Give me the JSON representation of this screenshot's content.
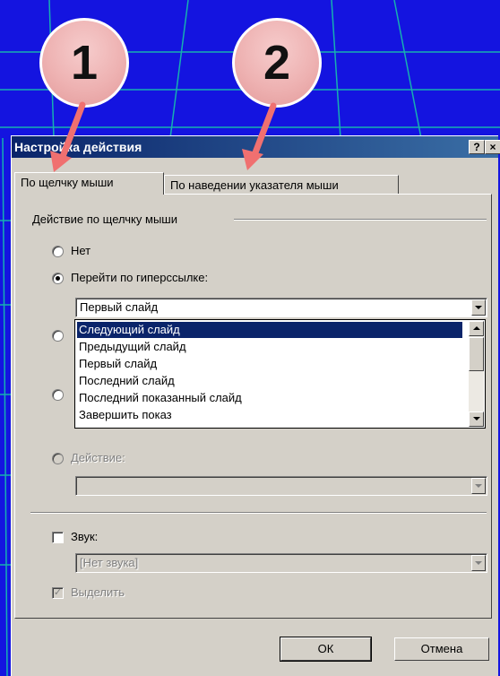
{
  "callouts": [
    "1",
    "2"
  ],
  "dialog": {
    "title": "Настройка действия",
    "help_label": "?",
    "close_label": "×",
    "tabs": [
      {
        "label": "По щелчку мыши",
        "active": true
      },
      {
        "label": "По наведении указателя мыши",
        "active": false
      }
    ],
    "group_label": "Действие по щелчку мыши",
    "options": {
      "none": "Нет",
      "hyperlink": "Перейти по гиперссылке:",
      "action": "Действие:"
    },
    "hyperlink_value": "Первый слайд",
    "dropdown_items": [
      "Следующий слайд",
      "Предыдущий слайд",
      "Первый слайд",
      "Последний слайд",
      "Последний показанный слайд",
      "Завершить показ"
    ],
    "selected_index": 0,
    "sound_label": "Звук:",
    "sound_value": "[Нет звука]",
    "highlight_label": "Выделить",
    "ok_label": "ОК",
    "cancel_label": "Отмена"
  },
  "colors": {
    "background": "#1414e0",
    "title_gradient_start": "#0a246a",
    "title_gradient_end": "#3a6ea5",
    "dialog_face": "#d4d0c8",
    "arrow": "#f07070",
    "selection": "#0a246a"
  }
}
